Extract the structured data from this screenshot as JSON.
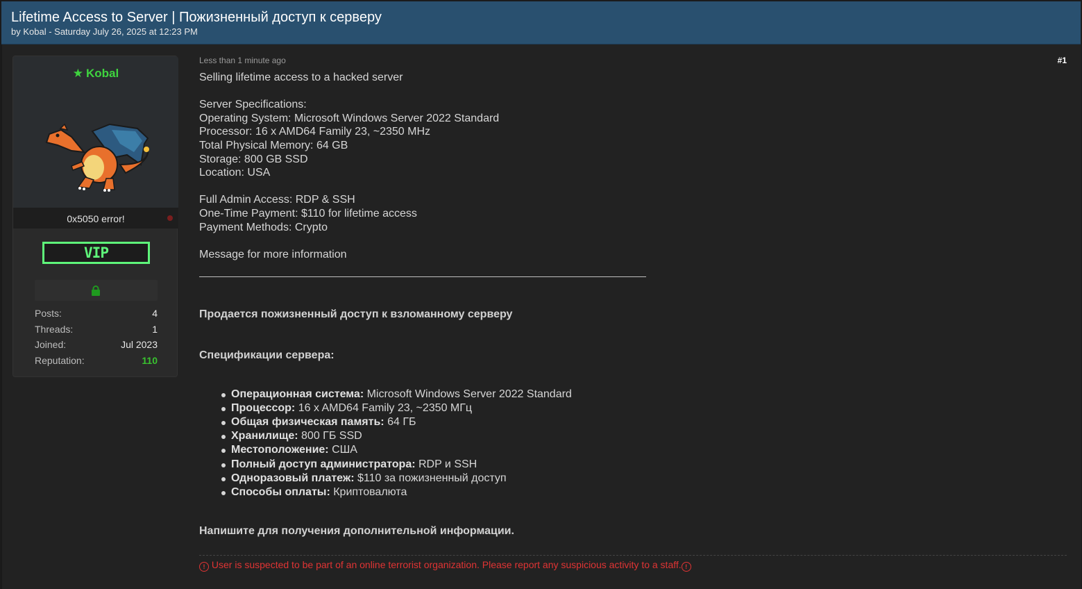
{
  "thread": {
    "title": "Lifetime Access to Server | Пожизненный доступ к серверу",
    "byline": "by Kobal - Saturday July 26, 2025 at 12:23 PM"
  },
  "user": {
    "name": "Kobal",
    "title": "0x5050 error!",
    "badge": "VIP",
    "stats": [
      {
        "label": "Posts:",
        "value": "4"
      },
      {
        "label": "Threads:",
        "value": "1"
      },
      {
        "label": "Joined:",
        "value": "Jul 2023"
      },
      {
        "label": "Reputation:",
        "value": "110"
      }
    ]
  },
  "post": {
    "time": "Less than 1 minute ago",
    "number": "#1",
    "en": {
      "intro": "Selling lifetime access to a hacked server",
      "spec_heading": "Server Specifications:",
      "specs": [
        "Operating System: Microsoft Windows Server 2022 Standard",
        "Processor: 16 x AMD64 Family 23, ~2350 MHz",
        "Total Physical Memory: 64 GB",
        "Storage: 800 GB SSD",
        "Location: USA"
      ],
      "terms": [
        "Full Admin Access: RDP & SSH",
        "One-Time Payment: $110 for lifetime access",
        "Payment Methods: Crypto"
      ],
      "outro": "Message for more information"
    },
    "ru": {
      "intro": "Продается пожизненный доступ к взломанному серверу",
      "spec_heading": "Спецификации сервера:",
      "specs": [
        {
          "label": "Операционная система:",
          "value": " Microsoft Windows Server 2022 Standard"
        },
        {
          "label": "Процессор:",
          "value": " 16 x AMD64 Family 23, ~2350 МГц"
        },
        {
          "label": "Общая физическая память:",
          "value": " 64 ГБ"
        },
        {
          "label": "Хранилище:",
          "value": " 800 ГБ SSD"
        },
        {
          "label": "Местоположение:",
          "value": " США"
        },
        {
          "label": "Полный доступ администратора:",
          "value": " RDP и SSH"
        },
        {
          "label": "Одноразовый платеж:",
          "value": " $110 за пожизненный доступ"
        },
        {
          "label": "Способы оплаты:",
          "value": " Криптовалюта"
        }
      ],
      "outro": "Напишите для получения дополнительной информации."
    },
    "warning": "User is suspected to be part of an online terrorist organization. Please report any suspicious activity to a staff."
  },
  "colors": {
    "header_bg": "#29506f",
    "username": "#3fd43f",
    "vip_border": "#5ef57a",
    "reputation": "#39c22f",
    "warning": "#e03434"
  },
  "icons": [
    "star-icon",
    "lock-icon",
    "warning-icon",
    "offline-status-dot"
  ]
}
